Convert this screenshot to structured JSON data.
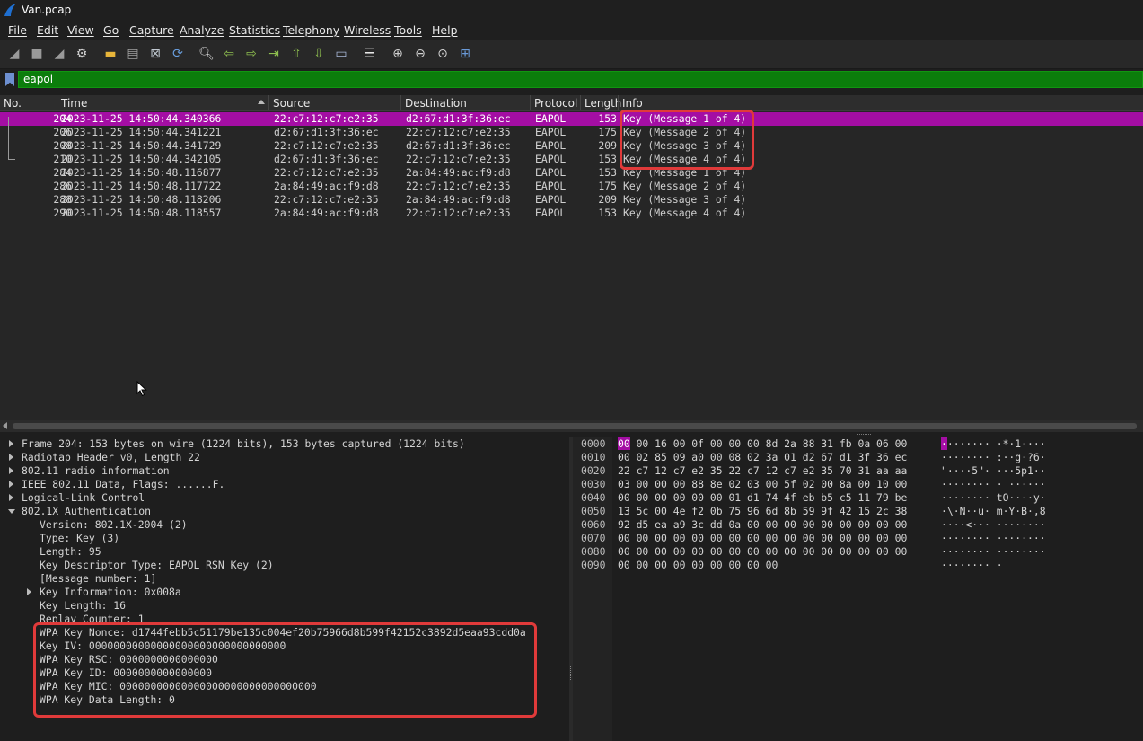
{
  "window": {
    "title": "Van.pcap"
  },
  "menu": [
    "File",
    "Edit",
    "View",
    "Go",
    "Capture",
    "Analyze",
    "Statistics",
    "Telephony",
    "Wireless",
    "Tools",
    "Help"
  ],
  "toolbar_icons": [
    "shark-fin-start-icon",
    "stop-square-icon",
    "restart-fin-icon",
    "gear-options-icon",
    "open-folder-icon",
    "save-file-icon",
    "close-file-icon",
    "reload-file-icon",
    "find-packet-icon",
    "go-back-icon",
    "go-forward-icon",
    "go-to-packet-icon",
    "go-first-icon",
    "go-last-icon",
    "autoscroll-icon",
    "colorize-icon",
    "zoom-in-icon",
    "zoom-out-icon",
    "zoom-normal-icon",
    "resize-columns-icon"
  ],
  "filter": {
    "value": "eapol"
  },
  "packet_list": {
    "columns": [
      "No.",
      "Time",
      "Source",
      "Destination",
      "Protocol",
      "Length",
      "Info"
    ],
    "rows": [
      {
        "no": "204",
        "time": "2023-11-25 14:50:44.340366",
        "src": "22:c7:12:c7:e2:35",
        "dst": "d2:67:d1:3f:36:ec",
        "proto": "EAPOL",
        "len": "153",
        "info": "Key (Message 1 of 4)"
      },
      {
        "no": "206",
        "time": "2023-11-25 14:50:44.341221",
        "src": "d2:67:d1:3f:36:ec",
        "dst": "22:c7:12:c7:e2:35",
        "proto": "EAPOL",
        "len": "175",
        "info": "Key (Message 2 of 4)"
      },
      {
        "no": "208",
        "time": "2023-11-25 14:50:44.341729",
        "src": "22:c7:12:c7:e2:35",
        "dst": "d2:67:d1:3f:36:ec",
        "proto": "EAPOL",
        "len": "209",
        "info": "Key (Message 3 of 4)"
      },
      {
        "no": "210",
        "time": "2023-11-25 14:50:44.342105",
        "src": "d2:67:d1:3f:36:ec",
        "dst": "22:c7:12:c7:e2:35",
        "proto": "EAPOL",
        "len": "153",
        "info": "Key (Message 4 of 4)"
      },
      {
        "no": "284",
        "time": "2023-11-25 14:50:48.116877",
        "src": "22:c7:12:c7:e2:35",
        "dst": "2a:84:49:ac:f9:d8",
        "proto": "EAPOL",
        "len": "153",
        "info": "Key (Message 1 of 4)"
      },
      {
        "no": "286",
        "time": "2023-11-25 14:50:48.117722",
        "src": "2a:84:49:ac:f9:d8",
        "dst": "22:c7:12:c7:e2:35",
        "proto": "EAPOL",
        "len": "175",
        "info": "Key (Message 2 of 4)"
      },
      {
        "no": "288",
        "time": "2023-11-25 14:50:48.118206",
        "src": "22:c7:12:c7:e2:35",
        "dst": "2a:84:49:ac:f9:d8",
        "proto": "EAPOL",
        "len": "209",
        "info": "Key (Message 3 of 4)"
      },
      {
        "no": "290",
        "time": "2023-11-25 14:50:48.118557",
        "src": "2a:84:49:ac:f9:d8",
        "dst": "22:c7:12:c7:e2:35",
        "proto": "EAPOL",
        "len": "153",
        "info": "Key (Message 4 of 4)"
      }
    ]
  },
  "details": [
    {
      "text": "Frame 204: 153 bytes on wire (1224 bits), 153 bytes captured (1224 bits)",
      "level": 0,
      "state": "collapsed"
    },
    {
      "text": "Radiotap Header v0, Length 22",
      "level": 0,
      "state": "collapsed"
    },
    {
      "text": "802.11 radio information",
      "level": 0,
      "state": "collapsed"
    },
    {
      "text": "IEEE 802.11 Data, Flags: ......F.",
      "level": 0,
      "state": "collapsed"
    },
    {
      "text": "Logical-Link Control",
      "level": 0,
      "state": "collapsed"
    },
    {
      "text": "802.1X Authentication",
      "level": 0,
      "state": "expanded"
    },
    {
      "text": "Version: 802.1X-2004 (2)",
      "level": 1,
      "state": "leaf"
    },
    {
      "text": "Type: Key (3)",
      "level": 1,
      "state": "leaf"
    },
    {
      "text": "Length: 95",
      "level": 1,
      "state": "leaf"
    },
    {
      "text": "Key Descriptor Type: EAPOL RSN Key (2)",
      "level": 1,
      "state": "leaf"
    },
    {
      "text": "[Message number: 1]",
      "level": 1,
      "state": "leaf"
    },
    {
      "text": "Key Information: 0x008a",
      "level": 1,
      "state": "collapsed"
    },
    {
      "text": "Key Length: 16",
      "level": 1,
      "state": "leaf"
    },
    {
      "text": "Replay Counter: 1",
      "level": 1,
      "state": "leaf"
    },
    {
      "text": "WPA Key Nonce: d1744febb5c51179be135c004ef20b75966d8b599f42152c3892d5eaa93cdd0a",
      "level": 1,
      "state": "leaf"
    },
    {
      "text": "Key IV: 00000000000000000000000000000000",
      "level": 1,
      "state": "leaf"
    },
    {
      "text": "WPA Key RSC: 0000000000000000",
      "level": 1,
      "state": "leaf"
    },
    {
      "text": "WPA Key ID: 0000000000000000",
      "level": 1,
      "state": "leaf"
    },
    {
      "text": "WPA Key MIC: 00000000000000000000000000000000",
      "level": 1,
      "state": "leaf"
    },
    {
      "text": "WPA Key Data Length: 0",
      "level": 1,
      "state": "leaf"
    }
  ],
  "bytes": [
    {
      "offset": "0000",
      "first": "00",
      "hex": "00 16 00 0f 00 00 00  8d 2a 88 31 fb 0a 06 00",
      "ascii_first": "·",
      "ascii": "······· ·*·1····"
    },
    {
      "offset": "0010",
      "first": "",
      "hex": "00 02 85 09 a0 00 08 02  3a 01 d2 67 d1 3f 36 ec",
      "ascii_first": "",
      "ascii": "········ :··g·?6·"
    },
    {
      "offset": "0020",
      "first": "",
      "hex": "22 c7 12 c7 e2 35 22 c7  12 c7 e2 35 70 31 aa aa",
      "ascii_first": "",
      "ascii": "\"····5\"· ···5p1··"
    },
    {
      "offset": "0030",
      "first": "",
      "hex": "03 00 00 00 88 8e 02 03  00 5f 02 00 8a 00 10 00",
      "ascii_first": "",
      "ascii": "········ ·_······"
    },
    {
      "offset": "0040",
      "first": "",
      "hex": "00 00 00 00 00 00 01 d1  74 4f eb b5 c5 11 79 be",
      "ascii_first": "",
      "ascii": "········ tO····y·"
    },
    {
      "offset": "0050",
      "first": "",
      "hex": "13 5c 00 4e f2 0b 75 96  6d 8b 59 9f 42 15 2c 38",
      "ascii_first": "",
      "ascii": "·\\·N··u· m·Y·B·,8"
    },
    {
      "offset": "0060",
      "first": "",
      "hex": "92 d5 ea a9 3c dd 0a 00  00 00 00 00 00 00 00 00",
      "ascii_first": "",
      "ascii": "····<··· ········"
    },
    {
      "offset": "0070",
      "first": "",
      "hex": "00 00 00 00 00 00 00 00  00 00 00 00 00 00 00 00",
      "ascii_first": "",
      "ascii": "········ ········"
    },
    {
      "offset": "0080",
      "first": "",
      "hex": "00 00 00 00 00 00 00 00  00 00 00 00 00 00 00 00",
      "ascii_first": "",
      "ascii": "········ ········"
    },
    {
      "offset": "0090",
      "first": "",
      "hex": "00 00 00 00 00 00 00 00  00",
      "ascii_first": "",
      "ascii": "········ ·"
    }
  ],
  "colors": {
    "selected_row": "#a40ea4",
    "filter_bg": "#0b7d0b",
    "annotation_box": "#e03a3a"
  }
}
